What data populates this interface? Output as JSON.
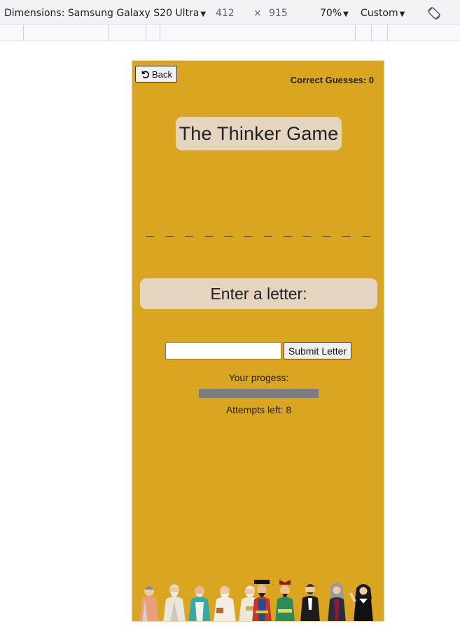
{
  "devtools": {
    "dimensions_label": "Dimensions: Samsung Galaxy S20 Ultra",
    "width": "412",
    "times": "×",
    "height": "915",
    "zoom": "70%",
    "throttle": "Custom",
    "rotate_icon": "rotate-icon"
  },
  "game": {
    "back_label": "Back",
    "back_icon": "undo-icon",
    "correct_guesses": "Correct Guesses: 0",
    "title": "The Thinker Game",
    "word_mask": "_ _ _ _ _   _ _ _ _ _ _ _",
    "prompt": "Enter a letter:",
    "input_value": "",
    "input_placeholder": "",
    "submit_label": "Submit Letter",
    "progress_label": "Your progess:",
    "progress_value": 0,
    "attempts": "Attempts left: 8",
    "illustration": "philosophers-illustration",
    "background_color": "#daa520",
    "panel_color": "#e5d5c0"
  }
}
